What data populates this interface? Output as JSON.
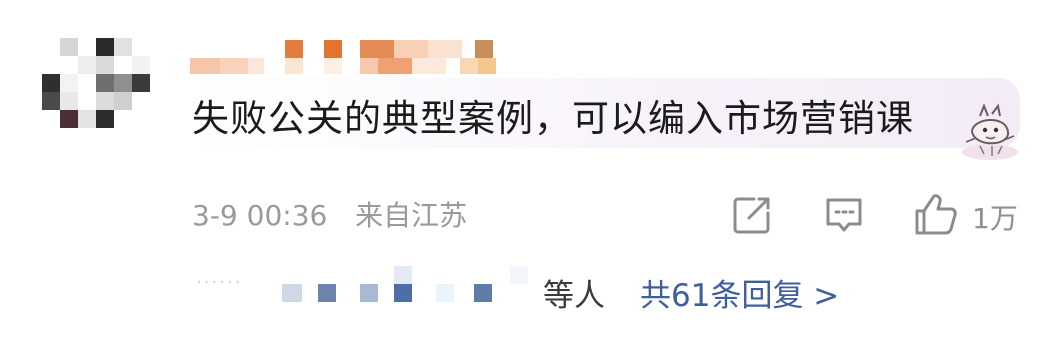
{
  "comment": {
    "text": "失败公关的典型案例，可以编入市场营销课",
    "time": "3-9 00:36",
    "location": "来自江苏",
    "avatar_icon": "pixelated-avatar",
    "sticker_icon": "cartoon-sticker"
  },
  "actions": {
    "share_icon": "share-edit-icon",
    "comment_icon": "comment-icon",
    "like_icon": "thumbs-up-icon",
    "like_count": "1万"
  },
  "replies": {
    "ellipsis": "······",
    "people_suffix": "等人",
    "total_label": "共61条回复 >"
  },
  "colors": {
    "link_blue": "#3d5f9e",
    "meta_gray": "#9a9a9a",
    "text_dark": "#1b1b1b"
  }
}
